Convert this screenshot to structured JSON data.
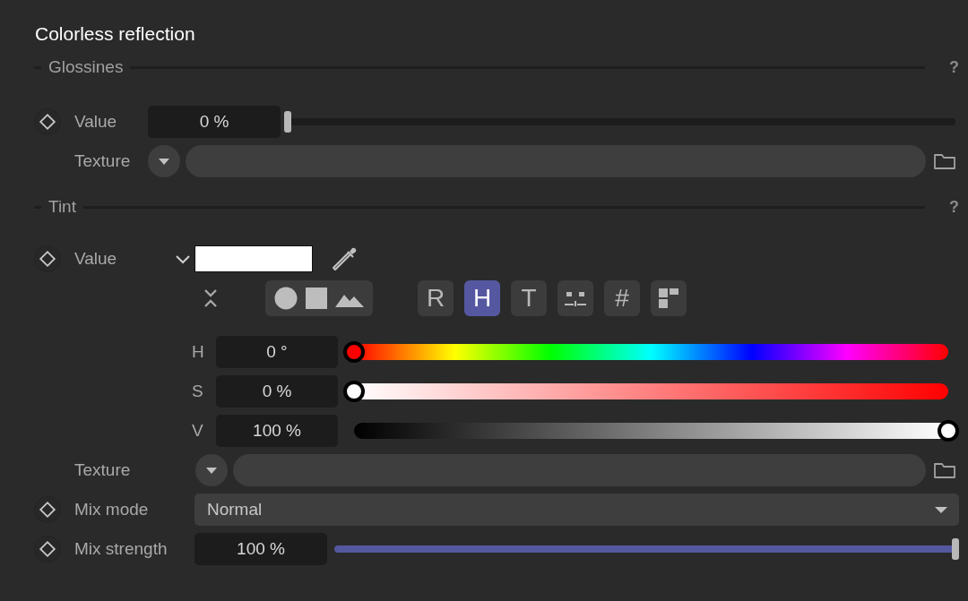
{
  "title": "Colorless reflection",
  "sections": [
    {
      "title": "Glossines",
      "help": "?",
      "rows": [
        {
          "kind": "slider",
          "label": "Value",
          "animatable": true,
          "value": "0 %",
          "level": 0
        },
        {
          "kind": "texture",
          "label": "Texture",
          "animatable": false
        }
      ]
    },
    {
      "title": "Tint",
      "help": "?",
      "rows": [
        {
          "kind": "color",
          "label": "Value",
          "animatable": true,
          "expanded": true,
          "modes": [
            {
              "kind": "letter",
              "label": "R",
              "selected": false
            },
            {
              "kind": "letter",
              "label": "H",
              "selected": true
            },
            {
              "kind": "letter",
              "label": "T",
              "selected": false
            },
            {
              "kind": "mixer",
              "selected": false
            },
            {
              "kind": "letter",
              "label": "#",
              "selected": false
            },
            {
              "kind": "swatches",
              "selected": false
            }
          ],
          "channels": [
            {
              "kind": "hue",
              "label": "H",
              "value": "0 °",
              "level": 0
            },
            {
              "kind": "saturation",
              "label": "S",
              "value": "0 %",
              "level": 0
            },
            {
              "kind": "brightness",
              "label": "V",
              "value": "100 %",
              "level": 1
            }
          ]
        },
        {
          "kind": "texture",
          "label": "Texture",
          "animatable": false
        },
        {
          "kind": "dropdown",
          "label": "Mix mode",
          "animatable": true,
          "value": "Normal"
        },
        {
          "kind": "slider",
          "label": "Mix strength",
          "animatable": true,
          "value": "100 %",
          "level": 1
        }
      ]
    }
  ]
}
